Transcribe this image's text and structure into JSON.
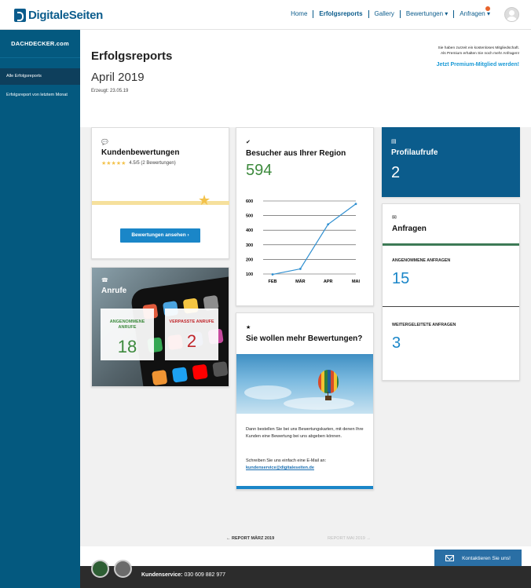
{
  "topbar": {
    "logo_text": "DigitaleSeiten",
    "nav": [
      {
        "label": "Home"
      },
      {
        "label": "Erfolgsreports"
      },
      {
        "label": "Gallery"
      },
      {
        "label": "Bewertungen ▾"
      },
      {
        "label": "Anfragen ▾"
      }
    ],
    "anfragen_badge": "2"
  },
  "sidebar": {
    "logo": "DACHDECKER.com",
    "items": [
      {
        "label": "Alle Erfolgsreports"
      },
      {
        "label": "Erfolgsreport von letztem Monat"
      }
    ]
  },
  "header": {
    "title": "Erfolgsreports",
    "month": "April 2019",
    "created": "Erzeugt: 23.05.19",
    "premium_note_1": "Sie haben zurzeit ein kostenloses Mitgliedschaft.",
    "premium_note_2": "Als Premium erhalten Sie noch mehr Anfragen!",
    "premium_link": "Jetzt Premium-Mitglied werden!"
  },
  "reviews": {
    "title": "Kundenbewertungen",
    "stars": "★★★★★",
    "rating": "4.5/5 (2 Bewertungen)",
    "button": "Bewertungen ansehen ›"
  },
  "calls": {
    "title": "Anrufe",
    "accepted_label": "ANGENOMMENE ANRUFE",
    "accepted": "18",
    "missed_label": "VERPASSTE ANRUFE",
    "missed": "2"
  },
  "visitors": {
    "title": "Besucher aus Ihrer Region",
    "total": "594"
  },
  "chart_data": {
    "type": "line",
    "categories": [
      "FEB",
      "MÄR",
      "APR",
      "MAI"
    ],
    "series": [
      {
        "values": [
          97,
          135,
          440,
          580
        ]
      }
    ],
    "ylim": [
      100,
      600
    ],
    "yticks": [
      100,
      200,
      300,
      400,
      500,
      600
    ],
    "grid": true
  },
  "more_reviews": {
    "title": "Sie wollen mehr Bewertungen?",
    "text1": "Dann bestellen Sie bei uns Bewertungskarten, mit denen Ihre Kunden eine Bewertung bei uns abgeben können.",
    "text2": "Schreiben Sie uns einfach eine E-Mail an:",
    "email": "kundenservice@digitaleseiten.de"
  },
  "profile": {
    "title": "Profilaufrufe",
    "value": "2"
  },
  "inquiries": {
    "title": "Anfragen",
    "accepted_label": "ANGENOMMENE ANFRAGEN",
    "accepted": "15",
    "forwarded_label": "WEITERGELEITETE ANFRAGEN",
    "forwarded": "3"
  },
  "pager": {
    "prev": "← REPORT MÄRZ 2019",
    "next": "REPORT MAI 2019 →"
  },
  "contact_button": "Kontaktieren Sie uns!",
  "footer": {
    "label": "Kundenservice:",
    "phone": "030 609 882 977"
  },
  "colors": {
    "primary": "#04597f",
    "accent": "#1a86c8",
    "green": "#3d8a3d",
    "red": "#c0262b"
  }
}
